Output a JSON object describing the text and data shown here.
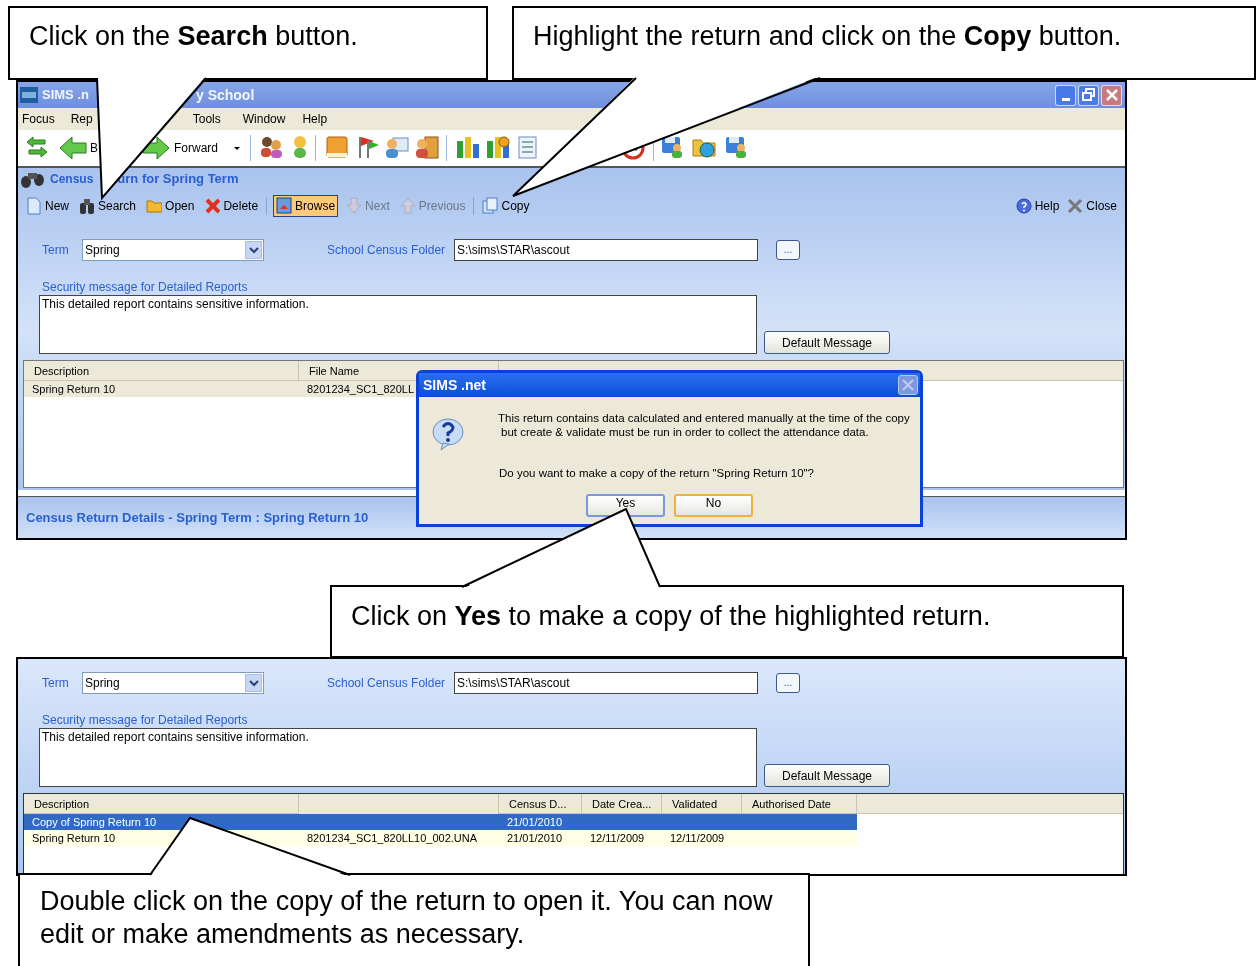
{
  "callouts": [
    {
      "text": "Click on the **Search** button."
    },
    {
      "text": "Highlight the return and click on the **Copy** button."
    },
    {
      "text": "Click on **Yes** to make a copy of the highlighted return."
    },
    {
      "text": "Double click on the copy of the return to open it. You can now edit or make amendments as necessary."
    }
  ],
  "screen_1": {
    "window": {
      "title_fragments": [
        "SIMS .n",
        "y School"
      ]
    },
    "menu": [
      {
        "label": "Focus"
      },
      {
        "label": "Rep"
      },
      {
        "label": "Tools"
      },
      {
        "label": "Window"
      },
      {
        "label": "Help"
      }
    ],
    "nav": {
      "back": "B",
      "forward": "Forward"
    },
    "panel": {
      "title_fragments": [
        "Census",
        "urn for Spring Term"
      ],
      "actions": [
        {
          "label": "New",
          "disabled": false,
          "pressed": false
        },
        {
          "label": "Search",
          "disabled": false,
          "pressed": false
        },
        {
          "label": "Open",
          "disabled": false,
          "pressed": false
        },
        {
          "label": "Delete",
          "disabled": false,
          "pressed": false
        },
        {
          "label": "Browse",
          "disabled": false,
          "pressed": true
        },
        {
          "label": "Next",
          "disabled": true,
          "pressed": false
        },
        {
          "label": "Previous",
          "disabled": true,
          "pressed": false
        },
        {
          "label": "Copy",
          "disabled": false,
          "pressed": false
        }
      ],
      "right_actions": [
        {
          "label": "Help"
        },
        {
          "label": "Close"
        }
      ]
    },
    "form": {
      "term_label": "Term",
      "term_value": "Spring",
      "folder_label": "School Census Folder",
      "folder_value": "S:\\sims\\STAR\\ascout",
      "browse_button": "...",
      "security_label": "Security message for Detailed Reports",
      "security_text": "This detailed report contains sensitive information.",
      "default_button": "Default Message"
    },
    "grid": {
      "focused": false,
      "columns": [
        {
          "label": "Description"
        },
        {
          "label": "File Name"
        }
      ],
      "rows": [
        {
          "description": "Spring Return 10",
          "file_name": "8201234_SC1_820LL",
          "selected": true
        }
      ]
    },
    "details_panel": {
      "title": "Census Return Details - Spring Term : Spring Return 10"
    },
    "dialog": {
      "title": "SIMS .net",
      "close_enabled": false,
      "message_lines": [
        "This return contains data calculated and entered manually at the time of the copy",
        "but create & validate must be run in order to collect the attendance data."
      ],
      "question": "Do you want to make a copy of the return \"Spring Return 10\"?",
      "buttons": [
        {
          "label": "Yes",
          "focused": true,
          "hovered": false
        },
        {
          "label": "No",
          "focused": false,
          "hovered": true
        }
      ]
    }
  },
  "screen_2": {
    "form": {
      "term_label": "Term",
      "term_value": "Spring",
      "folder_label": "School Census Folder",
      "folder_value": "S:\\sims\\STAR\\ascout",
      "browse_button": "...",
      "security_label": "Security message for Detailed Reports",
      "security_text": "This detailed report contains sensitive information.",
      "default_button": "Default Message"
    },
    "grid": {
      "focused": true,
      "columns": [
        {
          "label": "Description"
        },
        {
          "kind": "blank"
        },
        {
          "label": "Census D..."
        },
        {
          "label": "Date Crea..."
        },
        {
          "label": "Validated"
        },
        {
          "label": "Authorised Date"
        }
      ],
      "rows": [
        {
          "description": "Copy of Spring Return 10",
          "census_date": "21/01/2010",
          "selected": true
        },
        {
          "description": "Spring Return 10",
          "file_name": "8201234_SC1_820LL10_002.UNA",
          "census_date": "21/01/2010",
          "date_created": "12/11/2009",
          "validated": "12/11/2009",
          "selected": false
        }
      ]
    }
  }
}
